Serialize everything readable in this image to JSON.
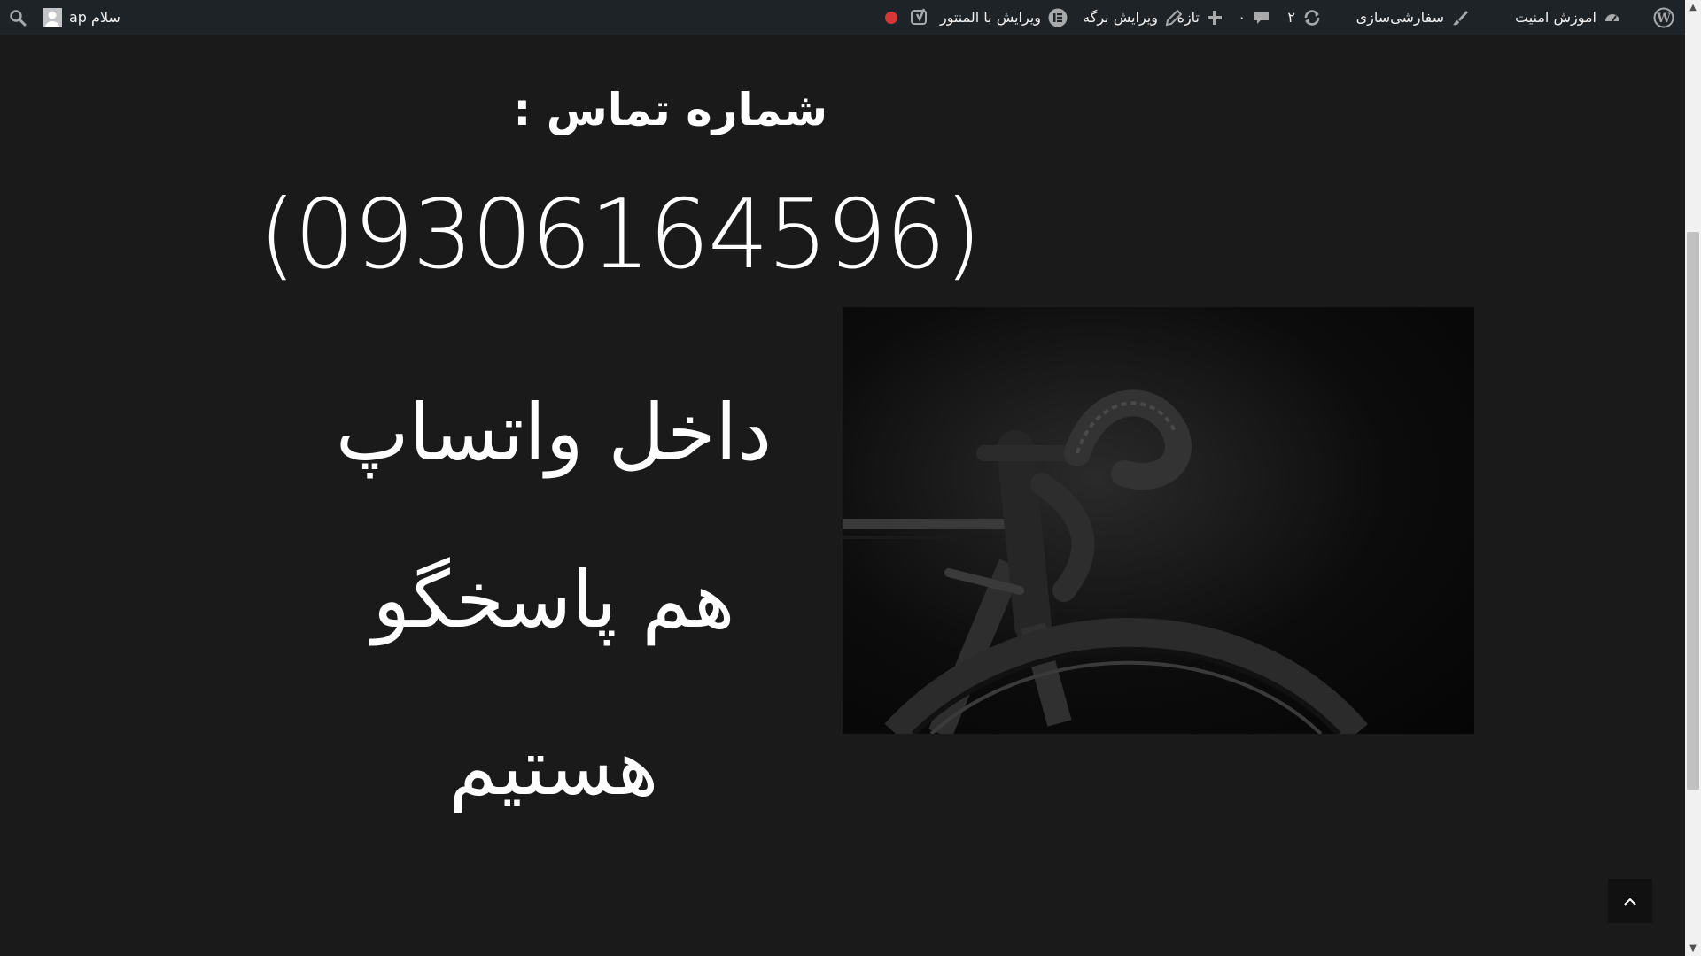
{
  "adminbar": {
    "greeting": "سلام ap",
    "site_name": "اموزش امنیت",
    "customize": "سفارشی‌سازی",
    "updates_count": "۲",
    "comments_count": "۰",
    "new_label": "تازه",
    "edit_page": "ویرایش برگه",
    "edit_elementor": "ویرایش با المنتور",
    "colors": {
      "bar_bg": "#1d2327",
      "status_dot": "#d63638"
    }
  },
  "content": {
    "heading": "شماره تماس :",
    "phone": "(09306164596)",
    "lines": [
      "داخل واتساپ",
      "هم پاسخگو",
      "هستیم"
    ],
    "colors": {
      "background": "#1a1a1a",
      "text": "#ffffff"
    }
  },
  "image": {
    "subject": "black road bicycle handlebar photo"
  },
  "icons": [
    "search-icon",
    "avatar",
    "wordpress-logo-icon",
    "dashboard-icon",
    "brush-icon",
    "updates-icon",
    "comments-icon",
    "plus-icon",
    "pencil-icon",
    "elementor-icon",
    "yoast-icon",
    "chevron-up-icon"
  ]
}
